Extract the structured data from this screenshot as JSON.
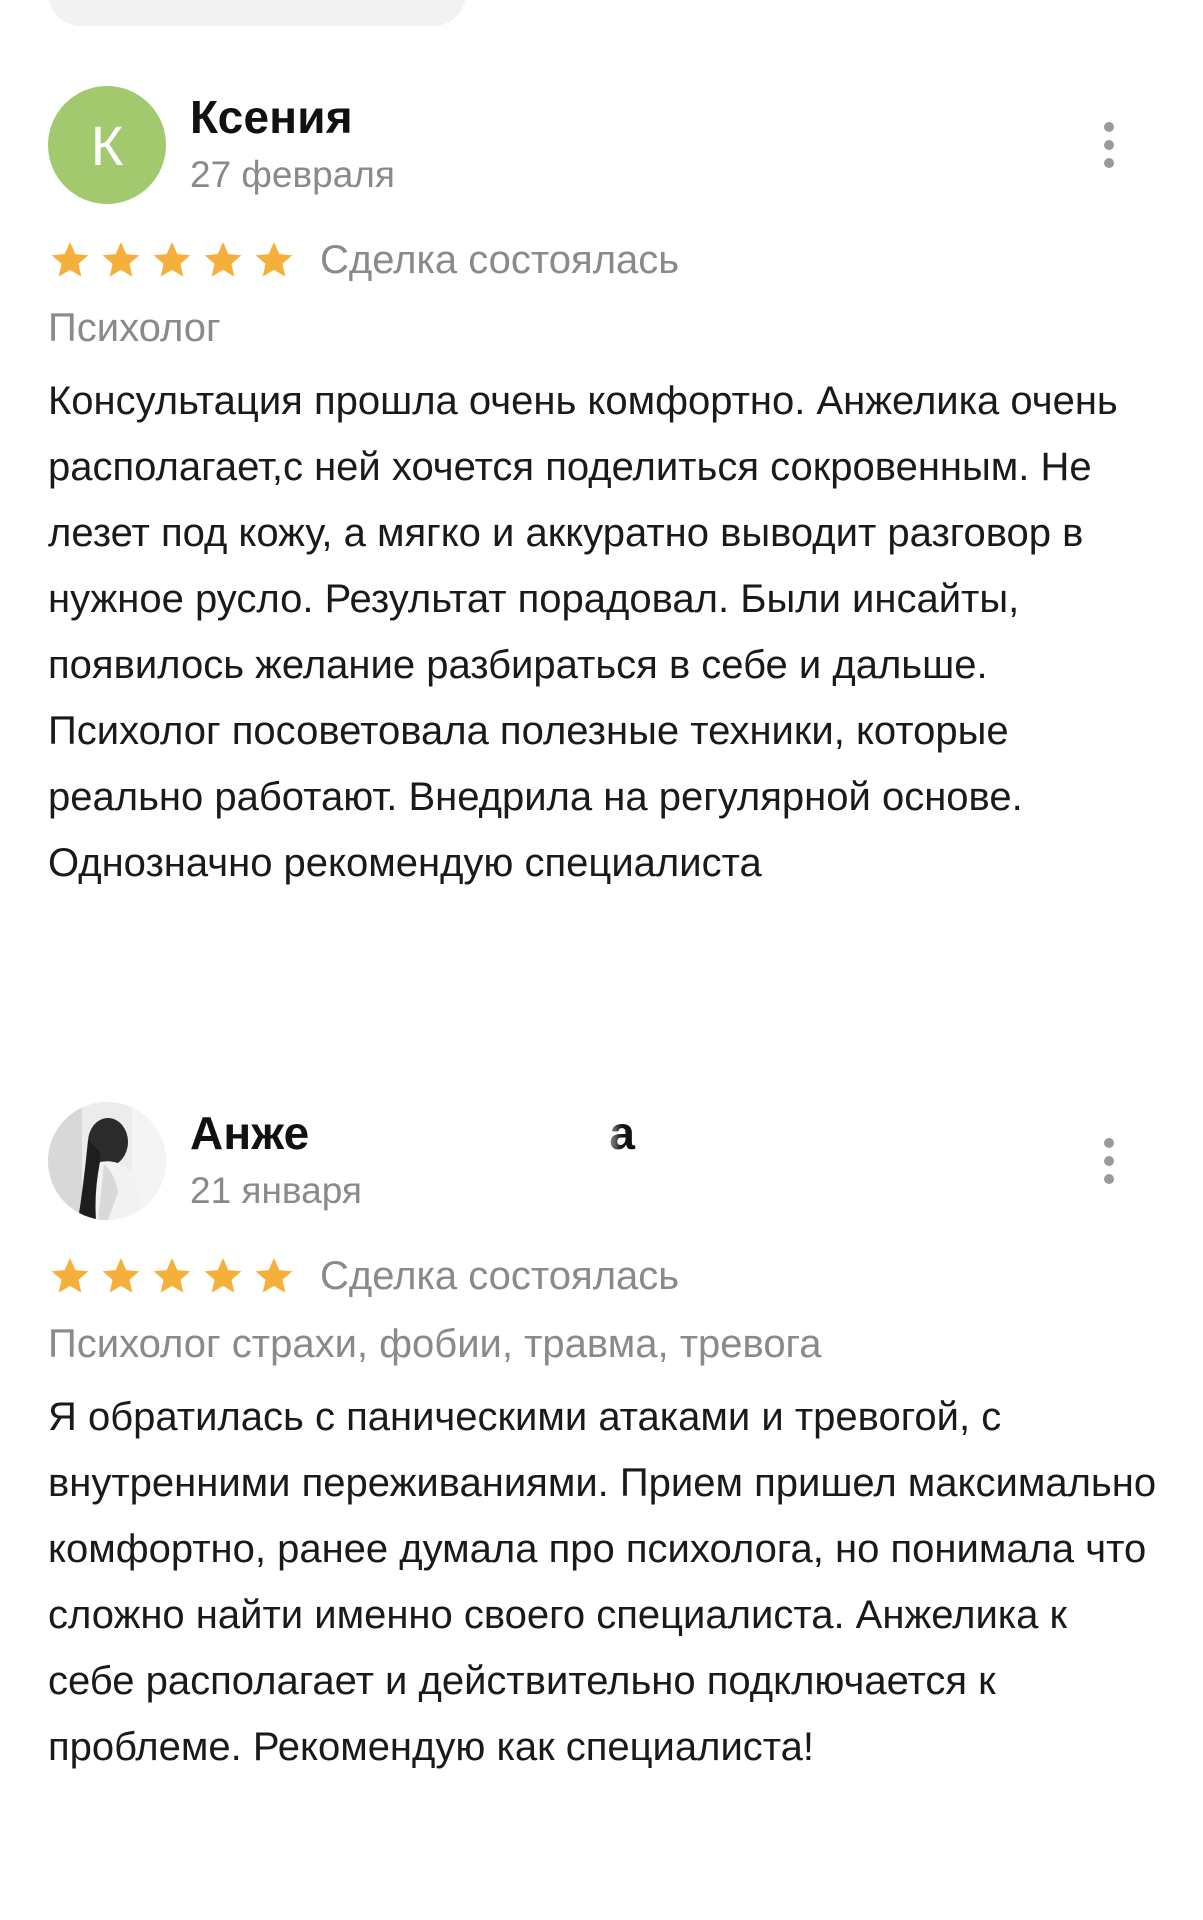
{
  "reviews": [
    {
      "author": "Ксения",
      "avatar_letter": "К",
      "avatar_color": "#a3c96e",
      "date": "27 февраля",
      "rating": 5,
      "deal_status": "Сделка состоялась",
      "category": "Психолог",
      "text": "Консультация прошла очень комфортно. Анжелика очень располагает,с ней хочется поделиться сокровенным. Не лезет под кожу, а мягко и аккуратно выводит разговор в нужное русло. Результат порадовал. Были инсайты, появилось желание разбираться в себе и дальше. Психолог посоветовала полезные техники, которые реально работают. Внедрила на регулярной основе. Однозначно рекомендую специалиста"
    },
    {
      "author": "Анже",
      "author_tail": "а",
      "date": "21 января",
      "rating": 5,
      "deal_status": "Сделка состоялась",
      "category": "Психолог страхи, фобии, травма, тревога",
      "text": "Я обратилась с паническими атаками и тревогой, с внутренними переживаниями. Прием пришел максимально комфортно, ранее думала про психолога, но понимала что сложно найти именно своего специалиста. Анжелика к себе располагает и действительно подключается к проблеме. Рекомендую как специалиста!"
    }
  ],
  "star_color": "#f5b03c",
  "icons": {
    "more": "more-vertical-icon",
    "star": "star-icon"
  }
}
